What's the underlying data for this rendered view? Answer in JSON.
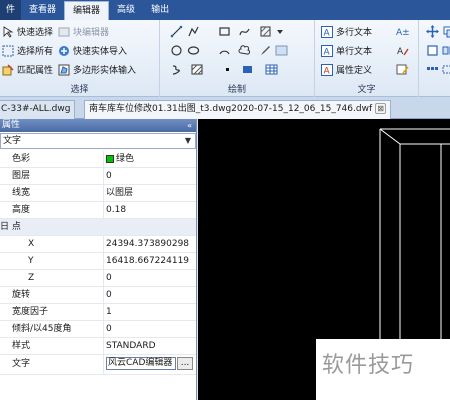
{
  "menubar": {
    "items": [
      "件",
      "查看器",
      "编辑器",
      "高级",
      "输出"
    ],
    "active_index": 2
  },
  "ribbon": {
    "select_group": {
      "label": "选择",
      "quick_select": "快速选择",
      "select_all": "选择所有",
      "match_props": "匹配属性",
      "block_editor": "块编辑器",
      "quick_entity_import": "快速实体导入",
      "polygon_entity_input": "多边形实体输入"
    },
    "draw_group": {
      "label": "绘制"
    },
    "text_group": {
      "label": "文字",
      "mtext": "多行文本",
      "stext": "单行文本",
      "attdef": "属性定义"
    }
  },
  "doctabs": {
    "tab1": "C-33#-ALL.dwg",
    "tab2": "南车库车位修改01.31出图_t3.dwg2020-07-15_12_06_15_746.dwf",
    "close_symbol": "⊠"
  },
  "panel": {
    "title": "属性",
    "pin_symbol": "«",
    "object_type": "文字",
    "rows": [
      {
        "name": "色彩",
        "value": "绿色"
      },
      {
        "name": "图层",
        "value": "0"
      },
      {
        "name": "线宽",
        "value": "以图层"
      },
      {
        "name": "高度",
        "value": "0.18"
      },
      {
        "name": "日 点",
        "value": ""
      },
      {
        "name": "X",
        "value": "24394.373890298"
      },
      {
        "name": "Y",
        "value": "16418.667224119"
      },
      {
        "name": "Z",
        "value": "0"
      },
      {
        "name": "旋转",
        "value": "0"
      },
      {
        "name": "宽度因子",
        "value": "1"
      },
      {
        "name": "倾斜/以45度角",
        "value": "0"
      },
      {
        "name": "样式",
        "value": "STANDARD"
      },
      {
        "name": "文字",
        "value": "风云CAD编辑器",
        "button": "..."
      }
    ]
  },
  "colors": {
    "menubar": "#2b579a",
    "ribbon": "#dde8f5",
    "canvas": "#000000",
    "green_swatch": "#00c400"
  },
  "watermark": {
    "text": "软件技巧"
  }
}
